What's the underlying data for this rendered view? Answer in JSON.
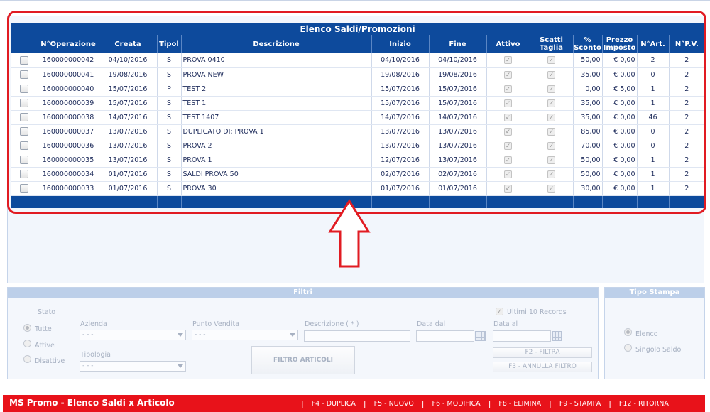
{
  "grid": {
    "title": "Elenco Saldi/Promozioni",
    "columns": [
      "N°Operazione",
      "Creata",
      "Tipol",
      "Descrizione",
      "Inizio",
      "Fine",
      "Attivo",
      "Scatti Taglia",
      "% Sconto",
      "Prezzo Imposto",
      "N°Art.",
      "N°P.V."
    ],
    "columns_split": {
      "scatti": [
        "Scatti",
        "Taglia"
      ],
      "sconto": [
        "%",
        "Sconto"
      ],
      "prezzo": [
        "Prezzo",
        "Imposto"
      ]
    },
    "rows": [
      {
        "nop": "160000000042",
        "creata": "04/10/2016",
        "tipol": "S",
        "descr": "PROVA 0410",
        "inizio": "04/10/2016",
        "fine": "04/10/2016",
        "sconto": "50,00",
        "prezzo": "€ 0,00",
        "nart": "2",
        "npv": "2"
      },
      {
        "nop": "160000000041",
        "creata": "19/08/2016",
        "tipol": "S",
        "descr": "PROVA NEW",
        "inizio": "19/08/2016",
        "fine": "19/08/2016",
        "sconto": "35,00",
        "prezzo": "€ 0,00",
        "nart": "0",
        "npv": "2"
      },
      {
        "nop": "160000000040",
        "creata": "15/07/2016",
        "tipol": "P",
        "descr": "TEST 2",
        "inizio": "15/07/2016",
        "fine": "15/07/2016",
        "sconto": "0,00",
        "prezzo": "€ 5,00",
        "nart": "1",
        "npv": "2"
      },
      {
        "nop": "160000000039",
        "creata": "15/07/2016",
        "tipol": "S",
        "descr": "TEST 1",
        "inizio": "15/07/2016",
        "fine": "15/07/2016",
        "sconto": "35,00",
        "prezzo": "€ 0,00",
        "nart": "1",
        "npv": "2"
      },
      {
        "nop": "160000000038",
        "creata": "14/07/2016",
        "tipol": "S",
        "descr": "TEST 1407",
        "inizio": "14/07/2016",
        "fine": "14/07/2016",
        "sconto": "35,00",
        "prezzo": "€ 0,00",
        "nart": "46",
        "npv": "2"
      },
      {
        "nop": "160000000037",
        "creata": "13/07/2016",
        "tipol": "S",
        "descr": "DUPLICATO DI: PROVA 1",
        "inizio": "13/07/2016",
        "fine": "13/07/2016",
        "sconto": "85,00",
        "prezzo": "€ 0,00",
        "nart": "0",
        "npv": "2"
      },
      {
        "nop": "160000000036",
        "creata": "13/07/2016",
        "tipol": "S",
        "descr": "PROVA 2",
        "inizio": "13/07/2016",
        "fine": "13/07/2016",
        "sconto": "70,00",
        "prezzo": "€ 0,00",
        "nart": "0",
        "npv": "2"
      },
      {
        "nop": "160000000035",
        "creata": "13/07/2016",
        "tipol": "S",
        "descr": "PROVA 1",
        "inizio": "12/07/2016",
        "fine": "13/07/2016",
        "sconto": "50,00",
        "prezzo": "€ 0,00",
        "nart": "1",
        "npv": "2"
      },
      {
        "nop": "160000000034",
        "creata": "01/07/2016",
        "tipol": "S",
        "descr": "SALDI PROVA 50",
        "inizio": "02/07/2016",
        "fine": "02/07/2016",
        "sconto": "50,00",
        "prezzo": "€ 0,00",
        "nart": "1",
        "npv": "2"
      },
      {
        "nop": "160000000033",
        "creata": "01/07/2016",
        "tipol": "S",
        "descr": "PROVA 30",
        "inizio": "01/07/2016",
        "fine": "01/07/2016",
        "sconto": "30,00",
        "prezzo": "€ 0,00",
        "nart": "1",
        "npv": "2"
      }
    ]
  },
  "filtri": {
    "title": "Filtri",
    "stato_label": "Stato",
    "stato_options": [
      "Tutte",
      "Attive",
      "Disattive"
    ],
    "stato_selected": "Tutte",
    "azienda_label": "Azienda",
    "azienda_value": "- - -",
    "punto_vendita_label": "Punto Vendita",
    "punto_vendita_value": "- - -",
    "descrizione_label": "Descrizione ( * )",
    "data_dal_label": "Data dal",
    "data_al_label": "Data al",
    "tipologia_label": "Tipologia",
    "tipologia_value": "- - -",
    "ultimi_label": "Ultimi 10 Records",
    "filtro_articoli": "FILTRO ARTICOLI",
    "filtra": "F2 - FILTRA",
    "annulla": "F3 - ANNULLA FILTRO"
  },
  "tipo_stampa": {
    "title": "Tipo Stampa",
    "options": [
      "Elenco",
      "Singolo Saldo"
    ],
    "selected": "Elenco"
  },
  "statusbar": {
    "title": "MS Promo - Elenco Saldi x Articolo",
    "keys": [
      "F4 - DUPLICA",
      "F5 - NUOVO",
      "F6 - MODIFICA",
      "F8 - ELIMINA",
      "F9 - STAMPA",
      "F12 - RITORNA"
    ]
  },
  "colors": {
    "header_blue": "#0d4a9c",
    "highlight_red": "#e11b22",
    "statusbar_red": "#e8121a"
  }
}
